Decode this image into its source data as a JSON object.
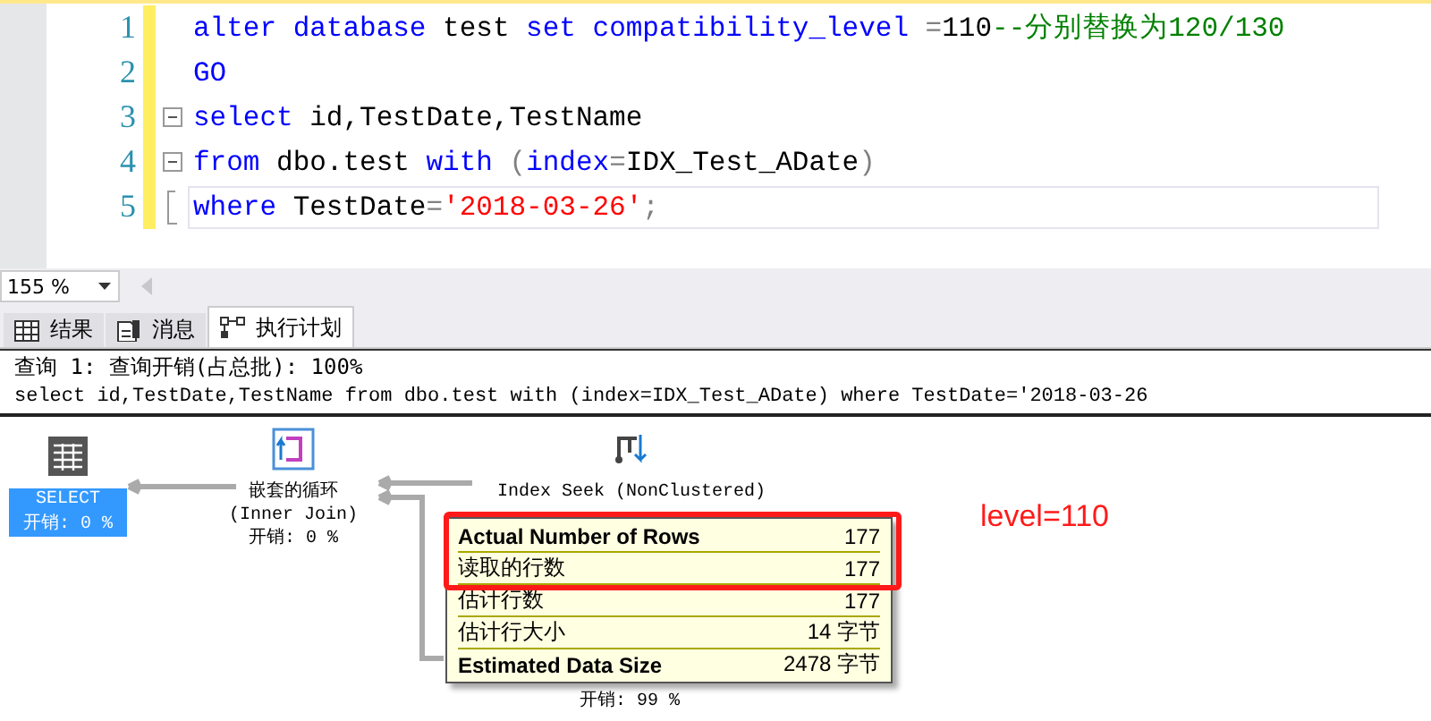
{
  "editor": {
    "lines": [
      {
        "number": "1",
        "kind": "plain",
        "current": false,
        "tokens": [
          {
            "text": "alter",
            "kind": "keyword"
          },
          {
            "text": " database",
            "kind": "keyword"
          },
          {
            "text": " test",
            "kind": "plain"
          },
          {
            "text": " set",
            "kind": "keyword"
          },
          {
            "text": " compatibility_level",
            "kind": "keyword"
          },
          {
            "text": " =",
            "kind": "punct"
          },
          {
            "text": "110",
            "kind": "plain"
          },
          {
            "text": "--分别替换为120/130",
            "kind": "comment"
          }
        ]
      },
      {
        "number": "2",
        "kind": "plain",
        "current": false,
        "tokens": [
          {
            "text": "GO",
            "kind": "keyword"
          }
        ]
      },
      {
        "number": "3",
        "kind": "fold_start",
        "current": false,
        "tokens": [
          {
            "text": "select",
            "kind": "keyword"
          },
          {
            "text": " id,TestDate,TestName",
            "kind": "plain"
          }
        ]
      },
      {
        "number": "4",
        "kind": "fold_start",
        "current": false,
        "tokens": [
          {
            "text": "from",
            "kind": "keyword"
          },
          {
            "text": " dbo.test ",
            "kind": "plain"
          },
          {
            "text": "with",
            "kind": "keyword"
          },
          {
            "text": " (",
            "kind": "punct"
          },
          {
            "text": "index",
            "kind": "keyword"
          },
          {
            "text": "=",
            "kind": "punct"
          },
          {
            "text": "IDX_Test_ADate",
            "kind": "plain"
          },
          {
            "text": ")",
            "kind": "punct"
          }
        ]
      },
      {
        "number": "5",
        "kind": "fold_end",
        "current": true,
        "tokens": [
          {
            "text": "where",
            "kind": "keyword"
          },
          {
            "text": " TestDate",
            "kind": "plain"
          },
          {
            "text": "=",
            "kind": "punct"
          },
          {
            "text": "'2018-03-26'",
            "kind": "string"
          },
          {
            "text": ";",
            "kind": "punct"
          }
        ]
      }
    ]
  },
  "zoom": {
    "value": "155 %"
  },
  "tabs": [
    {
      "label": "结果",
      "kind": "grid",
      "selected": false
    },
    {
      "label": "消息",
      "kind": "message",
      "selected": false
    },
    {
      "label": "执行计划",
      "kind": "plan",
      "selected": true
    }
  ],
  "plan": {
    "header": "查询 1: 查询开销(占总批): 100%",
    "sql": "select id,TestDate,TestName from dbo.test with (index=IDX_Test_ADate) where TestDate='2018-03-26",
    "nodes": [
      {
        "kind": "select",
        "label": "SELECT",
        "cost": "开销: 0 %",
        "selected": true
      },
      {
        "kind": "nested_loops",
        "label": "嵌套的循环",
        "sublabel": "(Inner Join)",
        "cost": "开销: 0 %",
        "selected": false
      },
      {
        "kind": "index_seek",
        "label": "Index Seek (NonClustered)",
        "cost": "开销: 99 %",
        "selected": false
      }
    ],
    "tooltip": {
      "rows": [
        {
          "name": "Actual Number of Rows",
          "value": "177",
          "bold": true
        },
        {
          "name": "读取的行数",
          "value": "177",
          "bold": false
        },
        {
          "name": "估计行数",
          "value": "177",
          "bold": false
        },
        {
          "name": "估计行大小",
          "value": "14 字节",
          "bold": false
        },
        {
          "name": "Estimated Data Size",
          "value": "2478 字节",
          "bold": true
        }
      ]
    },
    "annotation": {
      "text": "level=110"
    }
  }
}
